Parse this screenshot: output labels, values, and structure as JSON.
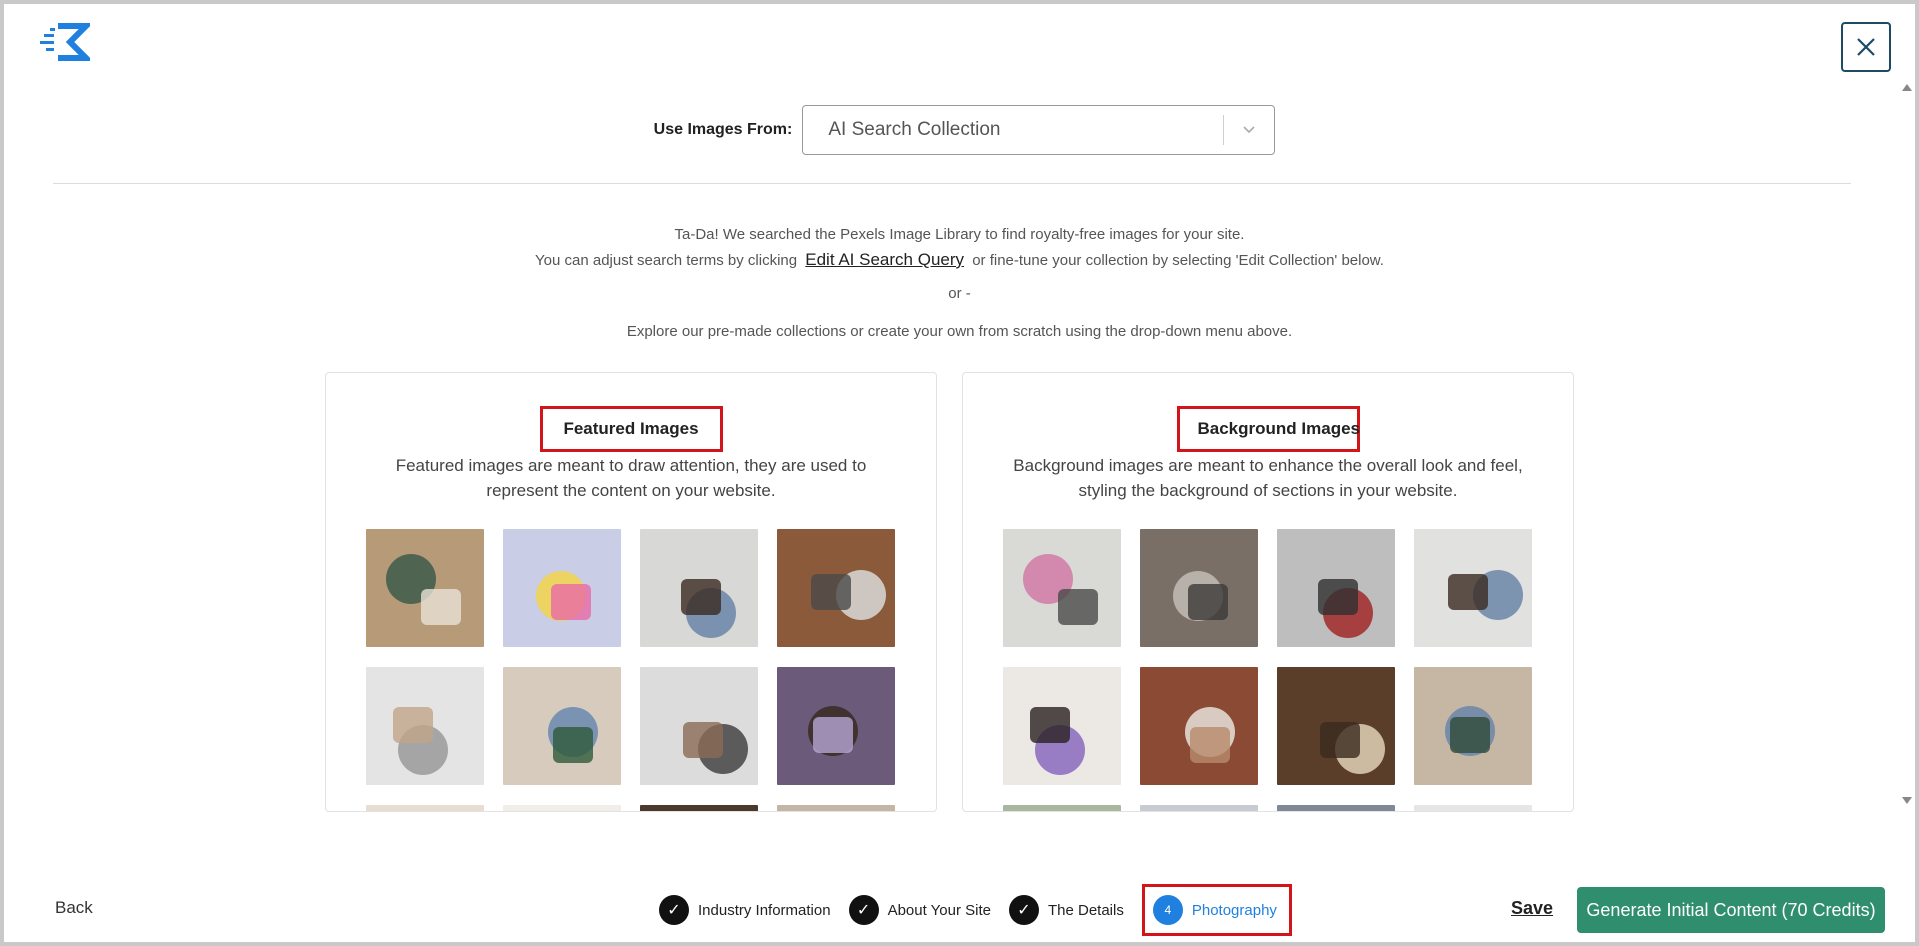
{
  "header": {
    "close_label": "✕"
  },
  "source": {
    "label": "Use Images From:",
    "selected": "AI Search Collection"
  },
  "intro": {
    "line1": "Ta-Da! We searched the Pexels Image Library to find royalty-free images for your site.",
    "line2_before": "You can adjust search terms by clicking",
    "edit_link": "Edit AI Search Query",
    "line2_after": "or fine-tune your collection by selecting 'Edit Collection' below.",
    "or": "or -",
    "explore": "Explore our pre-made collections or create your own from scratch using the drop-down menu above."
  },
  "featured": {
    "title": "Featured Images",
    "description_line1": "Featured images are meant to draw attention, they are used to",
    "description_line2": "represent the content on your website.",
    "thumbs": [
      {
        "bg": "#b79a78",
        "c1": "#3d5a4a",
        "c2": "#e8e1d6"
      },
      {
        "bg": "#c9cde6",
        "c1": "#f2d34a",
        "c2": "#e86aa6"
      },
      {
        "bg": "#d8d8d6",
        "c1": "#6a86a8",
        "c2": "#3b2b22"
      },
      {
        "bg": "#8a5a3a",
        "c1": "#d9d9d9",
        "c2": "#4a4a4a"
      },
      {
        "bg": "#e4e4e4",
        "c1": "#9a9a9a",
        "c2": "#c2a58a"
      },
      {
        "bg": "#d7cbbd",
        "c1": "#6a8ab0",
        "c2": "#2f5a3a"
      },
      {
        "bg": "#dcdcdc",
        "c1": "#444444",
        "c2": "#8a6a55"
      },
      {
        "bg": "#6b5a7a",
        "c1": "#3a2a22",
        "c2": "#b6a6d6"
      },
      {
        "bg": "#e8ddd2",
        "c1": "#b4a08a",
        "c2": "#ffffff"
      },
      {
        "bg": "#f1eeea",
        "c1": "#c9b5a0",
        "c2": "#e4d6c6"
      },
      {
        "bg": "#4a3a2e",
        "c1": "#2a221c",
        "c2": "#7a6a5a"
      },
      {
        "bg": "#c3b6a6",
        "c1": "#8a7a6a",
        "c2": "#e1d5c6"
      }
    ]
  },
  "background": {
    "title": "Background Images",
    "description_line1": "Background images are meant to enhance the overall look and feel,",
    "description_line2": "styling the background of sections in your website.",
    "thumbs": [
      {
        "bg": "#d9d9d6",
        "c1": "#d07aa6",
        "c2": "#4a4a4a"
      },
      {
        "bg": "#7a6f66",
        "c1": "#c2bdb6",
        "c2": "#3c3a38"
      },
      {
        "bg": "#bebebe",
        "c1": "#a22a2a",
        "c2": "#2f2f2f"
      },
      {
        "bg": "#e1e1df",
        "c1": "#6a86a8",
        "c2": "#3b2b22"
      },
      {
        "bg": "#ece8e4",
        "c1": "#8a6ac0",
        "c2": "#2b2020"
      },
      {
        "bg": "#8a4a34",
        "c1": "#e6e2dc",
        "c2": "#b88a6a"
      },
      {
        "bg": "#5b3e2a",
        "c1": "#e0d0b6",
        "c2": "#3a2a1e"
      },
      {
        "bg": "#c6b6a4",
        "c1": "#6a86a8",
        "c2": "#2f4a3a"
      },
      {
        "bg": "#a8b8a0",
        "c1": "#5a7a4a",
        "c2": "#e3e6de"
      },
      {
        "bg": "#c8ccd2",
        "c1": "#e6e6e6",
        "c2": "#9aa4b0"
      },
      {
        "bg": "#7f8a96",
        "c1": "#2e3a46",
        "c2": "#b8c0c8"
      },
      {
        "bg": "#e6e6e6",
        "c1": "#d0d0d0",
        "c2": "#f6f6f6"
      }
    ]
  },
  "footer": {
    "back": "Back",
    "steps": [
      {
        "label": "Industry Information",
        "icon": "✓"
      },
      {
        "label": "About Your Site",
        "icon": "✓"
      },
      {
        "label": "The Details",
        "icon": "✓"
      },
      {
        "label": "Photography",
        "icon": "4"
      }
    ],
    "save": "Save",
    "generate": "Generate Initial Content (70 Credits)"
  },
  "colors": {
    "accent_blue": "#1f80e0",
    "generate_green": "#2e8e6d",
    "highlight_red": "#d2141b"
  }
}
